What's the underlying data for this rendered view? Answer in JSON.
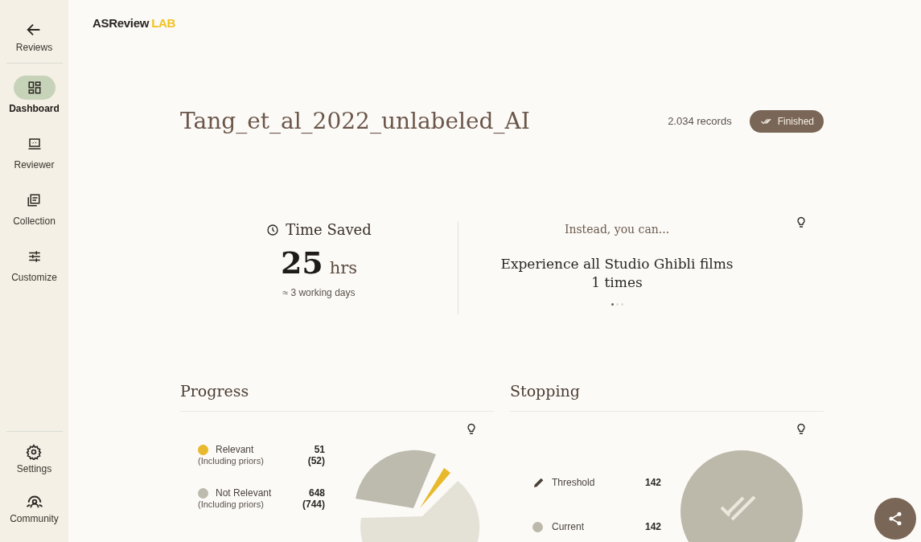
{
  "sidebar": {
    "back": {
      "label": "Reviews"
    },
    "items": [
      {
        "kind": "dashboard",
        "label": "Dashboard",
        "selected": true
      },
      {
        "kind": "reviewer",
        "label": "Reviewer",
        "selected": false
      },
      {
        "kind": "collection",
        "label": "Collection",
        "selected": false
      },
      {
        "kind": "customize",
        "label": "Customize",
        "selected": false
      }
    ],
    "bottom_items": [
      {
        "kind": "settings",
        "label": "Settings"
      },
      {
        "kind": "community",
        "label": "Community"
      }
    ]
  },
  "logo": {
    "main": "ASReview",
    "accent": "LAB"
  },
  "project": {
    "title": "Tang_et_al_2022_unlabeled_AI",
    "records": "2.034 records",
    "status": "Finished"
  },
  "time_saved": {
    "title": "Time Saved",
    "value": "25",
    "unit": "hrs",
    "note": "≈ 3 working days"
  },
  "suggestion": {
    "heading": "Instead, you can...",
    "text": "Experience all Studio Ghibli films 1 times",
    "dots": [
      {
        "selected": true
      },
      {
        "selected": false
      },
      {
        "selected": false
      }
    ]
  },
  "progress": {
    "title": "Progress",
    "legend": [
      {
        "label": "Relevant",
        "sub": "(Including priors)",
        "value": "51",
        "sub_value": "(52)",
        "color": "#e8b92c"
      },
      {
        "label": "Not Relevant",
        "sub": "(Including priors)",
        "value": "648",
        "sub_value": "(744)",
        "color": "#bdbaae"
      }
    ]
  },
  "stopping": {
    "title": "Stopping",
    "rows": [
      {
        "kind": "threshold",
        "label": "Threshold",
        "value": "142"
      },
      {
        "kind": "current",
        "label": "Current",
        "value": "142"
      }
    ]
  }
}
